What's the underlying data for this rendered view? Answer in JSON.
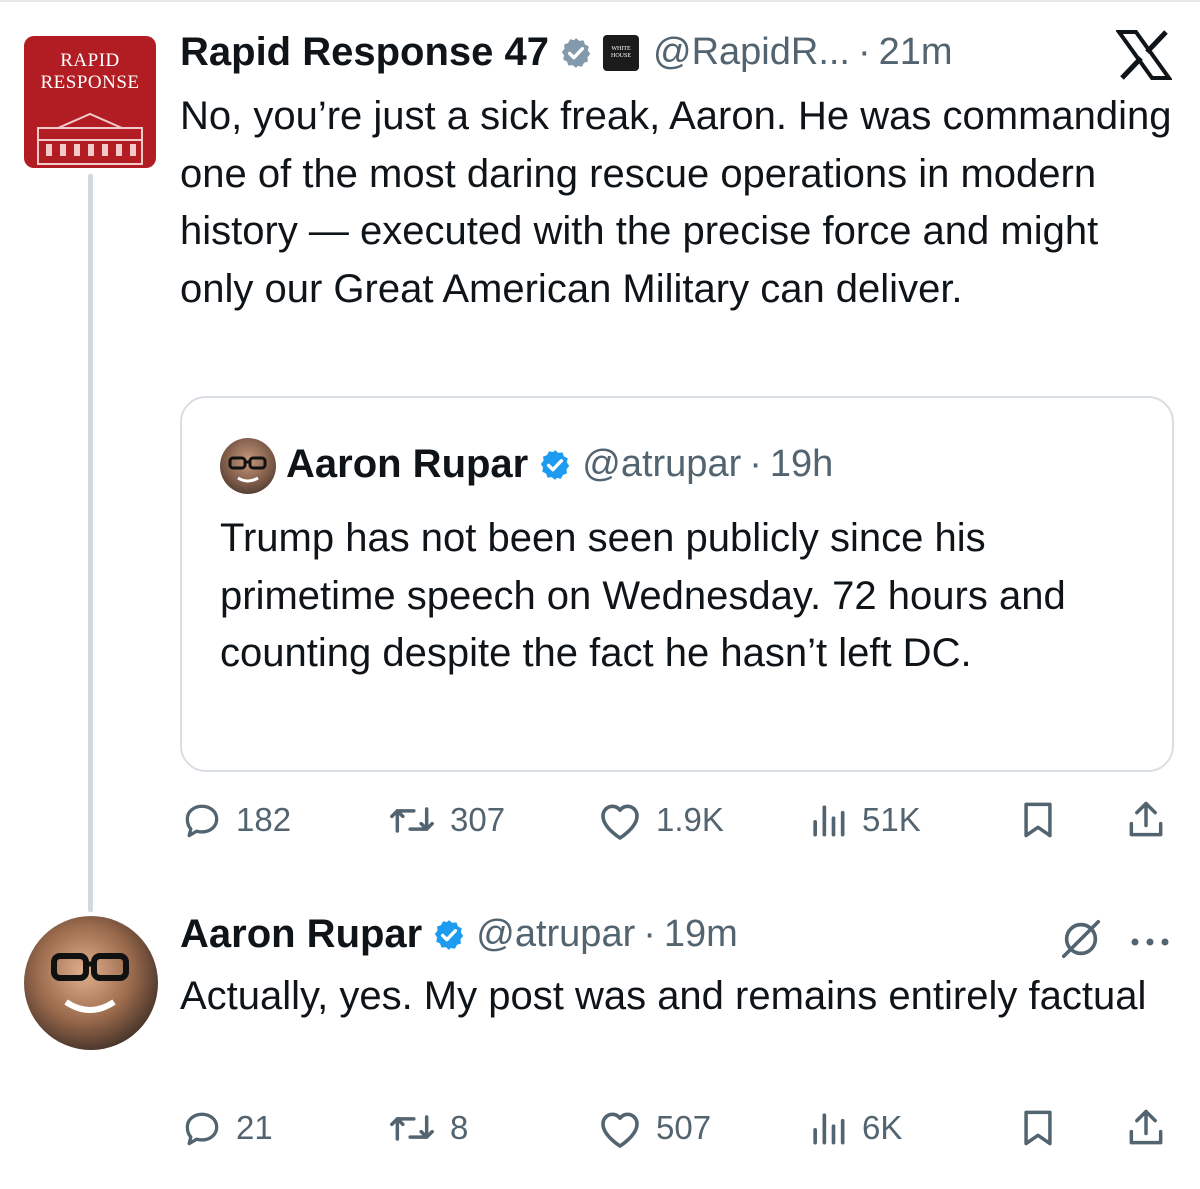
{
  "colors": {
    "verified": "#1d9bf0",
    "brand_red": "#b11d22",
    "muted": "#536471",
    "text": "#0f1419"
  },
  "main_post": {
    "avatar_text_line1": "RAPID",
    "avatar_text_line2": "RESPONSE",
    "name": "Rapid Response 47",
    "badge": "verified-gray-icon",
    "affiliate_badge_line1": "WHITE",
    "affiliate_badge_line2": "HOUSE",
    "handle": "@RapidR...",
    "separator": "·",
    "time": "21m",
    "text": "No, you’re just a sick freak, Aaron. He was commanding one of the most daring rescue operations in modern history — executed with the precise force and might only our Great American Military can deliver.",
    "stats": {
      "replies": "182",
      "reposts": "307",
      "likes": "1.9K",
      "views": "51K"
    }
  },
  "quoted_post": {
    "name": "Aaron Rupar",
    "badge": "verified-blue-icon",
    "handle": "@atrupar",
    "separator": "·",
    "time": "19h",
    "text": "Trump has not been seen publicly since his primetime speech on Wednesday. 72 hours and counting despite the fact he hasn’t left DC."
  },
  "reply_post": {
    "name": "Aaron Rupar",
    "badge": "verified-blue-icon",
    "handle": "@atrupar",
    "separator": "·",
    "time": "19m",
    "text": "Actually, yes. My post was and remains entirely factual",
    "stats": {
      "replies": "21",
      "reposts": "8",
      "likes": "507",
      "views": "6K"
    }
  },
  "app_logo": "x-logo-icon"
}
